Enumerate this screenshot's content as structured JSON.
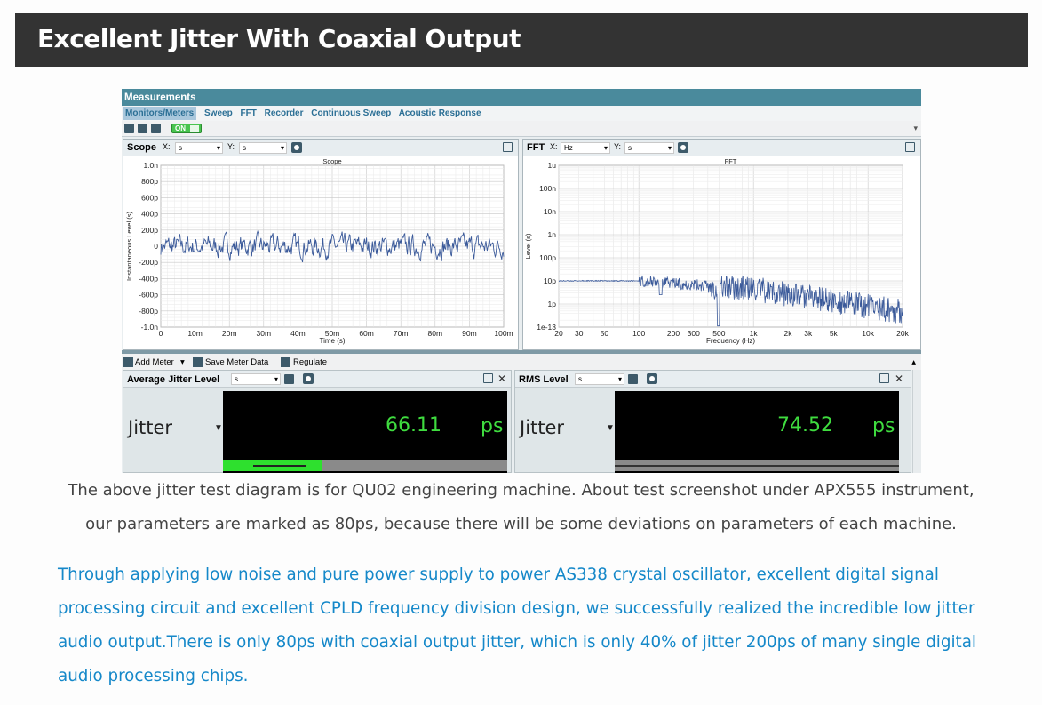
{
  "banner": {
    "title": "Excellent Jitter With Coaxial Output"
  },
  "app": {
    "title": "Measurements",
    "menu": [
      "Monitors/Meters",
      "Sweep",
      "FFT",
      "Recorder",
      "Continuous Sweep",
      "Acoustic Response"
    ],
    "on_label": "ON"
  },
  "scope_panel": {
    "title": "Scope",
    "x_label": "X:",
    "x_unit": "s",
    "y_label": "Y:",
    "y_unit": "s"
  },
  "fft_panel": {
    "title": "FFT",
    "x_label": "X:",
    "x_unit": "Hz",
    "y_label": "Y:",
    "y_unit": "s"
  },
  "meter_toolbar": {
    "add_meter": "Add Meter",
    "save_meter_data": "Save Meter Data",
    "regulate": "Regulate"
  },
  "meters": [
    {
      "title": "Average Jitter Level",
      "unit_select": "s",
      "label": "Jitter",
      "value": "66.11",
      "unit": "ps",
      "fill": 0.35
    },
    {
      "title": "RMS Level",
      "unit_select": "s",
      "label": "Jitter",
      "value": "74.52",
      "unit": "ps",
      "fill": 0.0
    }
  ],
  "caption": {
    "line1": "The above jitter test diagram is for QU02 engineering machine. About test screenshot under APX555 instrument,",
    "line2": "our parameters are marked as 80ps, because there will be some deviations on parameters of each machine."
  },
  "paragraph": {
    "line1": "Through applying low noise and pure power supply to power AS338 crystal oscillator, excellent digital signal",
    "line2": "processing circuit and excellent CPLD frequency division design, we successfully realized the incredible low jitter",
    "line3": "audio output.There is only 80ps with coaxial output jitter, which is only 40% of jitter 200ps of many single digital",
    "line4": "audio processing chips."
  },
  "colors": {
    "banner_bg": "#333333",
    "paragraph": "#1588c9",
    "trace": "#3b5a9a",
    "meter_green": "#3fdc3f"
  },
  "chart_data": [
    {
      "type": "line",
      "title": "Scope",
      "xlabel": "Time (s)",
      "ylabel": "Instantaneous Level (s)",
      "x_ticks": [
        "0",
        "10m",
        "20m",
        "30m",
        "40m",
        "50m",
        "60m",
        "70m",
        "80m",
        "90m",
        "100m"
      ],
      "y_ticks": [
        "1.0n",
        "800p",
        "600p",
        "400p",
        "200p",
        "0",
        "-200p",
        "-400p",
        "-600p",
        "-800p",
        "-1.0n"
      ],
      "xlim": [
        0,
        0.1
      ],
      "ylim": [
        -1e-09,
        1e-09
      ],
      "series": [
        {
          "description": "noise trace centered near 0 with amplitude about ±150p"
        }
      ],
      "grid": true
    },
    {
      "type": "line",
      "title": "FFT",
      "xlabel": "Frequency (Hz)",
      "ylabel": "Level (s)",
      "log_x": true,
      "log_y": true,
      "x_ticks": [
        "20",
        "30",
        "50",
        "100",
        "200",
        "300",
        "500",
        "1k",
        "2k",
        "3k",
        "5k",
        "10k",
        "20k"
      ],
      "y_ticks": [
        "1u",
        "100n",
        "10n",
        "1n",
        "100p",
        "10p",
        "1p",
        "1e-13"
      ],
      "xlim": [
        20,
        20000
      ],
      "ylim": [
        1e-13,
        1e-06
      ],
      "grid": true
    }
  ]
}
